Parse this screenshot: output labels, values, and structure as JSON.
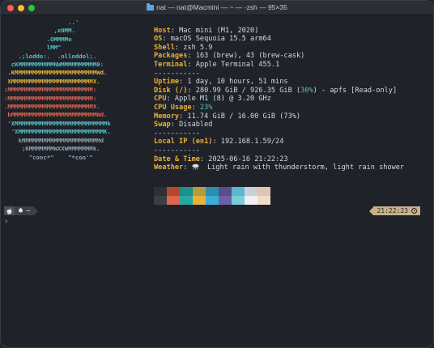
{
  "window": {
    "title": "nat — nat@Macmini — ~ — -zsh — 95×35",
    "folder_icon": "folder-icon"
  },
  "logo": {
    "lines": [
      {
        "text": "                  ..'",
        "color": "#56c1c8"
      },
      {
        "text": "              ,xNMM.",
        "color": "#56c1c8"
      },
      {
        "text": "            .OMMMMo",
        "color": "#56c1c8"
      },
      {
        "text": "            lMM\"",
        "color": "#56c1c8"
      },
      {
        "text": "    .;loddo:.  .olloddol;.",
        "color": "#56c1c8"
      },
      {
        "text": "  cKMMMMMMMMMMNWMMMMMMMMMM0:",
        "color": "#56c1c8"
      },
      {
        "text": " .KMMMMMMMMMMMMMMMMMMMMMMMWd.",
        "color": "#e8b13a"
      },
      {
        "text": " XMMMMMMMMMMMMMMMMMMMMMMMX.",
        "color": "#e8b13a"
      },
      {
        "text": ";MMMMMMMMMMMMMMMMMMMMMMMM:",
        "color": "#e0654f"
      },
      {
        "text": ":MMMMMMMMMMMMMMMMMMMMMMMM:",
        "color": "#e0654f"
      },
      {
        "text": ".MMMMMMMMMMMMMMMMMMMMMMMMX.",
        "color": "#e0654f"
      },
      {
        "text": " kMMMMMMMMMMMMMMMMMMMMMMMMWd.",
        "color": "#e0654f"
      },
      {
        "text": " 'XMMMMMMMMMMMMMMMMMMMMMMMMMMk",
        "color": "#56c1c8"
      },
      {
        "text": "  'XMMMMMMMMMMMMMMMMMMMMMMMMK.",
        "color": "#56c1c8"
      },
      {
        "text": "    kMMMMMMMMMMMMMMMMMMMMMMd",
        "color": "#8fa3b3"
      },
      {
        "text": "     ;KMMMMMMMWXXWMMMMMMMk.",
        "color": "#8fa3b3"
      },
      {
        "text": "       \"cooc*\"    \"*coo'\"",
        "color": "#8fa3b3"
      }
    ]
  },
  "info": {
    "user_host": "Host: Mac mini (M1, 2020)",
    "rows": [
      {
        "key": "Host",
        "value": "Mac mini (M1, 2020)"
      },
      {
        "key": "OS",
        "value": "macOS Sequoia 15.5 arm64"
      },
      {
        "key": "Shell",
        "value": "zsh 5.9"
      },
      {
        "key": "Packages",
        "value": "163 (brew), 43 (brew-cask)"
      },
      {
        "key": "Terminal",
        "value": "Apple Terminal 455.1"
      }
    ],
    "sep1": "-----------",
    "rows2": [
      {
        "key": "Uptime",
        "value": "1 day, 10 hours, 51 mins"
      },
      {
        "key": "Disk (/)",
        "value_pre": "280.99 GiB / 926.35 GiB (",
        "value_hl": "30%",
        "value_post": ") - apfs [Read-only]"
      },
      {
        "key": "CPU",
        "value": "Apple M1 (8) @ 3.20 GHz"
      },
      {
        "key": "CPU Usage",
        "value_hl": "23%"
      },
      {
        "key": "Memory",
        "value": "11.74 GiB / 16.00 GiB (73%)"
      },
      {
        "key": "Swap",
        "value": "Disabled"
      }
    ],
    "sep2": "-----------",
    "local_ip_key": "Local IP (en1)",
    "local_ip_value": "192.168.1.59/24",
    "sep3": "-----------",
    "datetime_key": "Date & Time",
    "datetime_value": "2025-06-16 21:22:23",
    "weather_key": "Weather",
    "weather_icon": "rain-cloud-icon",
    "weather_value": "Light rain with thunderstorm, light rain shower"
  },
  "swatches": {
    "row1": [
      "#2c2f35",
      "#b7472a",
      "#1e8f8a",
      "#b79a3a",
      "#2a8fb5",
      "#5a4c8f",
      "#5ab8c9",
      "#c9d0d6",
      "#e0c6b0"
    ],
    "row2": [
      "#3a3e45",
      "#e0654f",
      "#2aa7a0",
      "#e8b13a",
      "#3aaed8",
      "#6b5fa8",
      "#7ccbd8",
      "#eef1f3",
      "#f0dcc8"
    ]
  },
  "prompt": {
    "apple_icon": "apple-icon",
    "home_label": "~",
    "home_icon": "home-icon",
    "time": "21:22:23",
    "clock_icon": "clock-icon",
    "cursor_glyph": "›"
  },
  "colors": {
    "background": "#1f2228",
    "key": "#e8b13a",
    "highlight": "#56c1c8",
    "prompt_time_bg": "#c8b08a"
  }
}
